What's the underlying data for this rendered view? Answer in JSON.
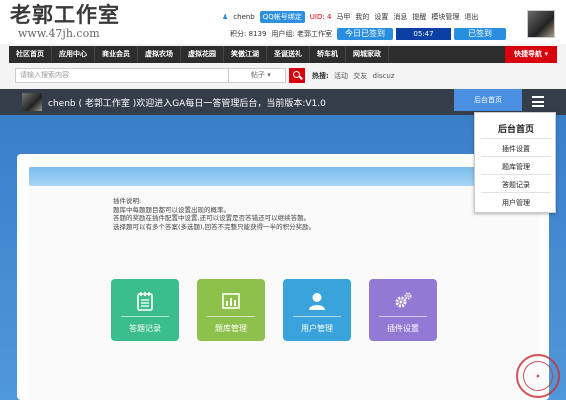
{
  "logo": {
    "name": "老郭工作室",
    "url": "www.47jh.com"
  },
  "userbar": {
    "username": "chenb",
    "qq_badge": "QQ帐号绑定",
    "uid": "UID: 4",
    "links": [
      "马甲",
      "我的",
      "设置",
      "消息",
      "提醒",
      "模块管理",
      "退出"
    ]
  },
  "userrow2": {
    "points": "积分: 8139",
    "group": "用户组: 老郭工作室",
    "signed_today": "今日已签到",
    "time": "05:47",
    "signed": "已签到"
  },
  "nav": {
    "items": [
      "社区首页",
      "应用中心",
      "商业会员",
      "虚拟农场",
      "虚拟花园",
      "笑傲江湖",
      "圣诞送礼",
      "轿车机",
      "网城家政"
    ],
    "quick": "快捷导航"
  },
  "search": {
    "placeholder": "请输入搜索内容",
    "type": "帖子",
    "hot_label": "热搜:",
    "hot": [
      "活动",
      "交友",
      "discuz"
    ]
  },
  "admin": {
    "title": "chenb ( 老郭工作室 )欢迎进入GA每日一答管理后台，当前版本:V1.0",
    "home_button": "后台首页"
  },
  "menu": {
    "title": "后台首页",
    "items": [
      "插件设置",
      "题库管理",
      "答题记录",
      "用户管理"
    ]
  },
  "description": {
    "lines": [
      "插件说明:",
      "题库中每题题目都可以设置出现的概率。",
      "答题的奖励在插件配置中设置,还可以设置是否答错还可以继续答题。",
      "选择题可以有多个答案(多选题),回答不完整只能获得一半的积分奖励。"
    ]
  },
  "tiles": [
    {
      "label": "答题记录",
      "color": "#3cbd8f",
      "icon": "notebook-icon"
    },
    {
      "label": "题库管理",
      "color": "#8dc14b",
      "icon": "chart-icon"
    },
    {
      "label": "用户管理",
      "color": "#3aa3dc",
      "icon": "user-icon"
    },
    {
      "label": "插件设置",
      "color": "#9279d4",
      "icon": "gears-icon"
    }
  ]
}
